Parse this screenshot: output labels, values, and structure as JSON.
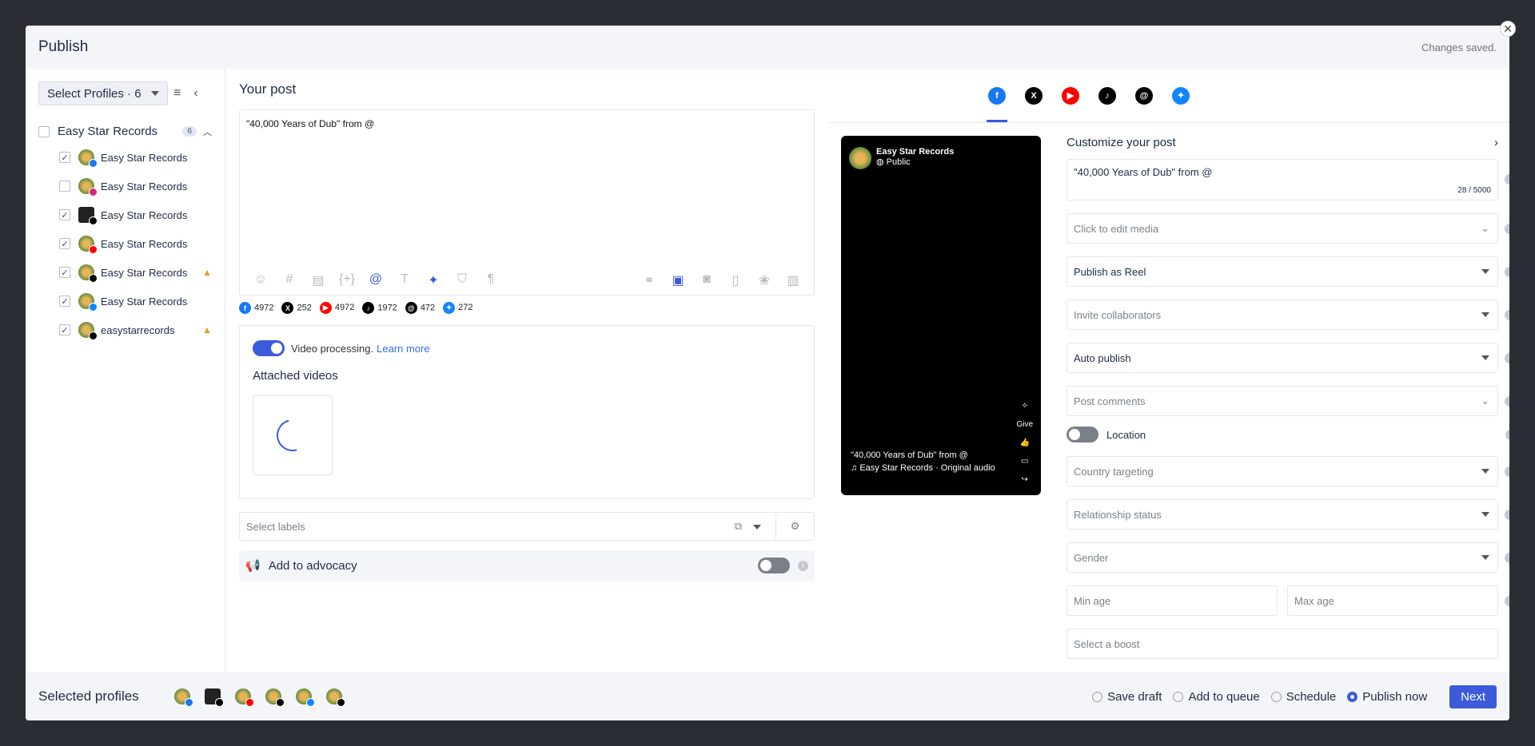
{
  "header": {
    "title": "Publish",
    "status": "Changes saved."
  },
  "left": {
    "select_profiles": "Select Profiles · 6",
    "group": {
      "name": "Easy Star Records",
      "count": "6"
    },
    "profiles": [
      {
        "name": "Easy Star Records",
        "checked": true,
        "network": "facebook",
        "warn": false
      },
      {
        "name": "Easy Star Records",
        "checked": false,
        "network": "instagram",
        "warn": false
      },
      {
        "name": "Easy Star Records",
        "checked": true,
        "network": "x",
        "warn": false
      },
      {
        "name": "Easy Star Records",
        "checked": true,
        "network": "youtube",
        "warn": false
      },
      {
        "name": "Easy Star Records",
        "checked": true,
        "network": "tiktok",
        "warn": true
      },
      {
        "name": "Easy Star Records",
        "checked": true,
        "network": "bluesky",
        "warn": false
      },
      {
        "name": "easystarrecords",
        "checked": true,
        "network": "threads",
        "warn": true
      }
    ]
  },
  "post": {
    "title": "Your post",
    "text": "\"40,000 Years of Dub\" from @",
    "counts": [
      {
        "net": "facebook",
        "value": "4972"
      },
      {
        "net": "x",
        "value": "252"
      },
      {
        "net": "youtube",
        "value": "4972"
      },
      {
        "net": "tiktok",
        "value": "1972"
      },
      {
        "net": "threads",
        "value": "472"
      },
      {
        "net": "bluesky",
        "value": "272"
      }
    ],
    "video_processing": "Video processing.",
    "learn_more": "Learn more",
    "attached_videos": "Attached videos",
    "labels_placeholder": "Select labels",
    "advocacy": "Add to advocacy"
  },
  "preview": {
    "name": "Easy Star Records",
    "visibility": "Public",
    "caption": "\"40,000 Years of Dub\" from @",
    "audio": "Easy Star Records · Original audio",
    "give": "Give"
  },
  "customize": {
    "title": "Customize your post",
    "text": "\"40,000 Years of Dub\" from @",
    "char_count": "28 / 5000",
    "media": "Click to edit media",
    "publish_as": "Publish as Reel",
    "collaborators": "Invite collaborators",
    "auto_publish": "Auto publish",
    "comments": "Post comments",
    "location": "Location",
    "country": "Country targeting",
    "relationship": "Relationship status",
    "gender": "Gender",
    "min_age": "Min age",
    "max_age": "Max age",
    "boost": "Select a boost"
  },
  "footer": {
    "title": "Selected profiles",
    "options": [
      "Save draft",
      "Add to queue",
      "Schedule",
      "Publish now"
    ],
    "selected": "Publish now",
    "next": "Next"
  },
  "colors": {
    "accent": "#3b5bdb",
    "facebook": "#1877f2",
    "youtube": "#ff0000",
    "bluesky": "#1185fe",
    "warning": "#e69a1b"
  }
}
